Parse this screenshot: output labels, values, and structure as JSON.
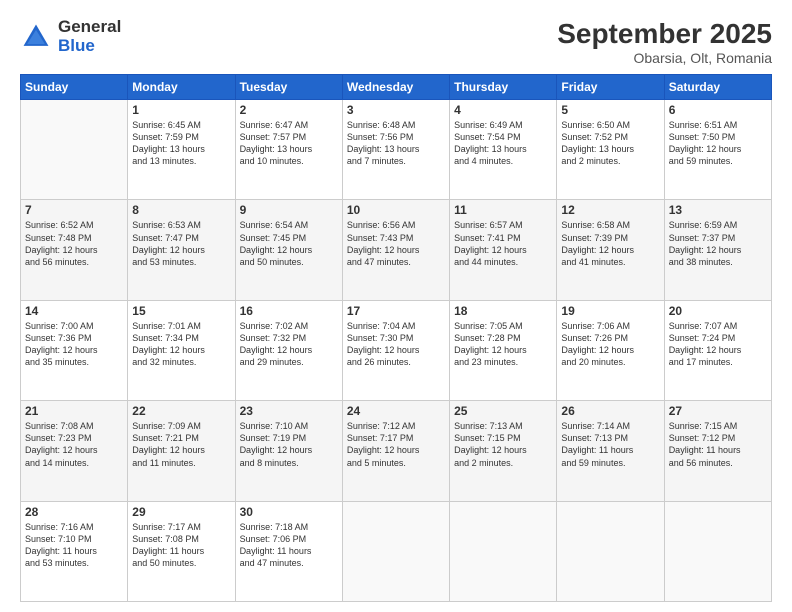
{
  "header": {
    "logo_general": "General",
    "logo_blue": "Blue",
    "month_title": "September 2025",
    "location": "Obarsia, Olt, Romania"
  },
  "weekdays": [
    "Sunday",
    "Monday",
    "Tuesday",
    "Wednesday",
    "Thursday",
    "Friday",
    "Saturday"
  ],
  "weeks": [
    [
      {
        "day": "",
        "text": ""
      },
      {
        "day": "1",
        "text": "Sunrise: 6:45 AM\nSunset: 7:59 PM\nDaylight: 13 hours\nand 13 minutes."
      },
      {
        "day": "2",
        "text": "Sunrise: 6:47 AM\nSunset: 7:57 PM\nDaylight: 13 hours\nand 10 minutes."
      },
      {
        "day": "3",
        "text": "Sunrise: 6:48 AM\nSunset: 7:56 PM\nDaylight: 13 hours\nand 7 minutes."
      },
      {
        "day": "4",
        "text": "Sunrise: 6:49 AM\nSunset: 7:54 PM\nDaylight: 13 hours\nand 4 minutes."
      },
      {
        "day": "5",
        "text": "Sunrise: 6:50 AM\nSunset: 7:52 PM\nDaylight: 13 hours\nand 2 minutes."
      },
      {
        "day": "6",
        "text": "Sunrise: 6:51 AM\nSunset: 7:50 PM\nDaylight: 12 hours\nand 59 minutes."
      }
    ],
    [
      {
        "day": "7",
        "text": "Sunrise: 6:52 AM\nSunset: 7:48 PM\nDaylight: 12 hours\nand 56 minutes."
      },
      {
        "day": "8",
        "text": "Sunrise: 6:53 AM\nSunset: 7:47 PM\nDaylight: 12 hours\nand 53 minutes."
      },
      {
        "day": "9",
        "text": "Sunrise: 6:54 AM\nSunset: 7:45 PM\nDaylight: 12 hours\nand 50 minutes."
      },
      {
        "day": "10",
        "text": "Sunrise: 6:56 AM\nSunset: 7:43 PM\nDaylight: 12 hours\nand 47 minutes."
      },
      {
        "day": "11",
        "text": "Sunrise: 6:57 AM\nSunset: 7:41 PM\nDaylight: 12 hours\nand 44 minutes."
      },
      {
        "day": "12",
        "text": "Sunrise: 6:58 AM\nSunset: 7:39 PM\nDaylight: 12 hours\nand 41 minutes."
      },
      {
        "day": "13",
        "text": "Sunrise: 6:59 AM\nSunset: 7:37 PM\nDaylight: 12 hours\nand 38 minutes."
      }
    ],
    [
      {
        "day": "14",
        "text": "Sunrise: 7:00 AM\nSunset: 7:36 PM\nDaylight: 12 hours\nand 35 minutes."
      },
      {
        "day": "15",
        "text": "Sunrise: 7:01 AM\nSunset: 7:34 PM\nDaylight: 12 hours\nand 32 minutes."
      },
      {
        "day": "16",
        "text": "Sunrise: 7:02 AM\nSunset: 7:32 PM\nDaylight: 12 hours\nand 29 minutes."
      },
      {
        "day": "17",
        "text": "Sunrise: 7:04 AM\nSunset: 7:30 PM\nDaylight: 12 hours\nand 26 minutes."
      },
      {
        "day": "18",
        "text": "Sunrise: 7:05 AM\nSunset: 7:28 PM\nDaylight: 12 hours\nand 23 minutes."
      },
      {
        "day": "19",
        "text": "Sunrise: 7:06 AM\nSunset: 7:26 PM\nDaylight: 12 hours\nand 20 minutes."
      },
      {
        "day": "20",
        "text": "Sunrise: 7:07 AM\nSunset: 7:24 PM\nDaylight: 12 hours\nand 17 minutes."
      }
    ],
    [
      {
        "day": "21",
        "text": "Sunrise: 7:08 AM\nSunset: 7:23 PM\nDaylight: 12 hours\nand 14 minutes."
      },
      {
        "day": "22",
        "text": "Sunrise: 7:09 AM\nSunset: 7:21 PM\nDaylight: 12 hours\nand 11 minutes."
      },
      {
        "day": "23",
        "text": "Sunrise: 7:10 AM\nSunset: 7:19 PM\nDaylight: 12 hours\nand 8 minutes."
      },
      {
        "day": "24",
        "text": "Sunrise: 7:12 AM\nSunset: 7:17 PM\nDaylight: 12 hours\nand 5 minutes."
      },
      {
        "day": "25",
        "text": "Sunrise: 7:13 AM\nSunset: 7:15 PM\nDaylight: 12 hours\nand 2 minutes."
      },
      {
        "day": "26",
        "text": "Sunrise: 7:14 AM\nSunset: 7:13 PM\nDaylight: 11 hours\nand 59 minutes."
      },
      {
        "day": "27",
        "text": "Sunrise: 7:15 AM\nSunset: 7:12 PM\nDaylight: 11 hours\nand 56 minutes."
      }
    ],
    [
      {
        "day": "28",
        "text": "Sunrise: 7:16 AM\nSunset: 7:10 PM\nDaylight: 11 hours\nand 53 minutes."
      },
      {
        "day": "29",
        "text": "Sunrise: 7:17 AM\nSunset: 7:08 PM\nDaylight: 11 hours\nand 50 minutes."
      },
      {
        "day": "30",
        "text": "Sunrise: 7:18 AM\nSunset: 7:06 PM\nDaylight: 11 hours\nand 47 minutes."
      },
      {
        "day": "",
        "text": ""
      },
      {
        "day": "",
        "text": ""
      },
      {
        "day": "",
        "text": ""
      },
      {
        "day": "",
        "text": ""
      }
    ]
  ]
}
